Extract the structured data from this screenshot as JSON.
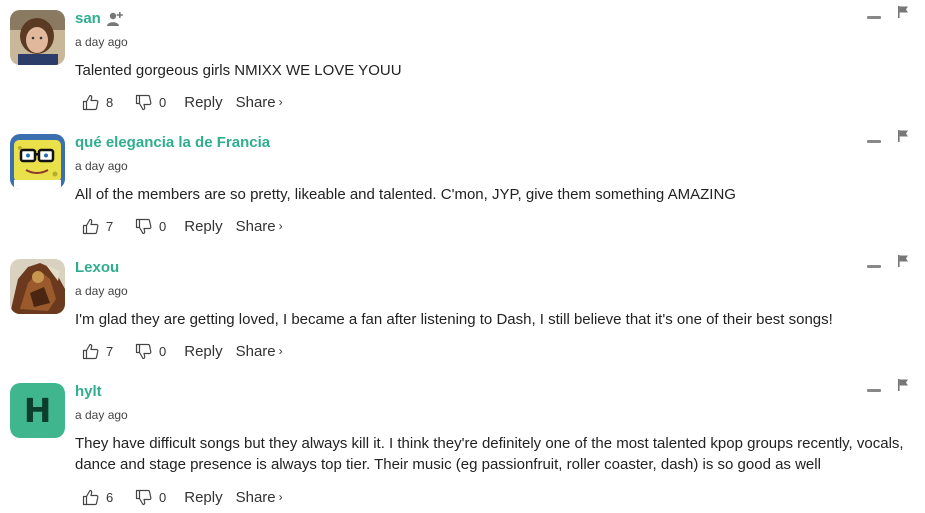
{
  "comments": [
    {
      "user": "san",
      "avatar": "photo-avatar",
      "time": "a day ago",
      "text": "Talented gorgeous girls NMIXX WE LOVE YOUU",
      "likes": "8",
      "dislikes": "0",
      "reply_label": "Reply",
      "share_label": "Share",
      "share_chevron": "›"
    },
    {
      "user": "qué elegancia la de Francia",
      "avatar": "spongebob-avatar",
      "time": "a day ago",
      "text": "All of the members are so pretty, likeable and talented. C'mon, JYP, give them something AMAZING",
      "likes": "7",
      "dislikes": "0",
      "reply_label": "Reply",
      "share_label": "Share",
      "share_chevron": "›"
    },
    {
      "user": "Lexou",
      "avatar": "artwork-avatar",
      "time": "a day ago",
      "text": "I'm glad they are getting loved, I became a fan after listening to Dash, I still believe that it's one of their best songs!",
      "likes": "7",
      "dislikes": "0",
      "reply_label": "Reply",
      "share_label": "Share",
      "share_chevron": "›"
    },
    {
      "user": "hylt",
      "avatar_letter": "H",
      "avatar_color": "#3fb68e",
      "time": "a day ago",
      "text": "They have difficult songs but they always kill it. I think they're definitely one of the most talented kpop groups recently, vocals, dance and stage presence is always top tier. Their music (eg passionfruit, roller coaster, dash) is so good as well",
      "likes": "6",
      "dislikes": "0",
      "reply_label": "Reply",
      "share_label": "Share",
      "share_chevron": "›"
    }
  ],
  "colors": {
    "username": "#2fae8f",
    "avatar_letter_bg": "#3fb68e"
  }
}
